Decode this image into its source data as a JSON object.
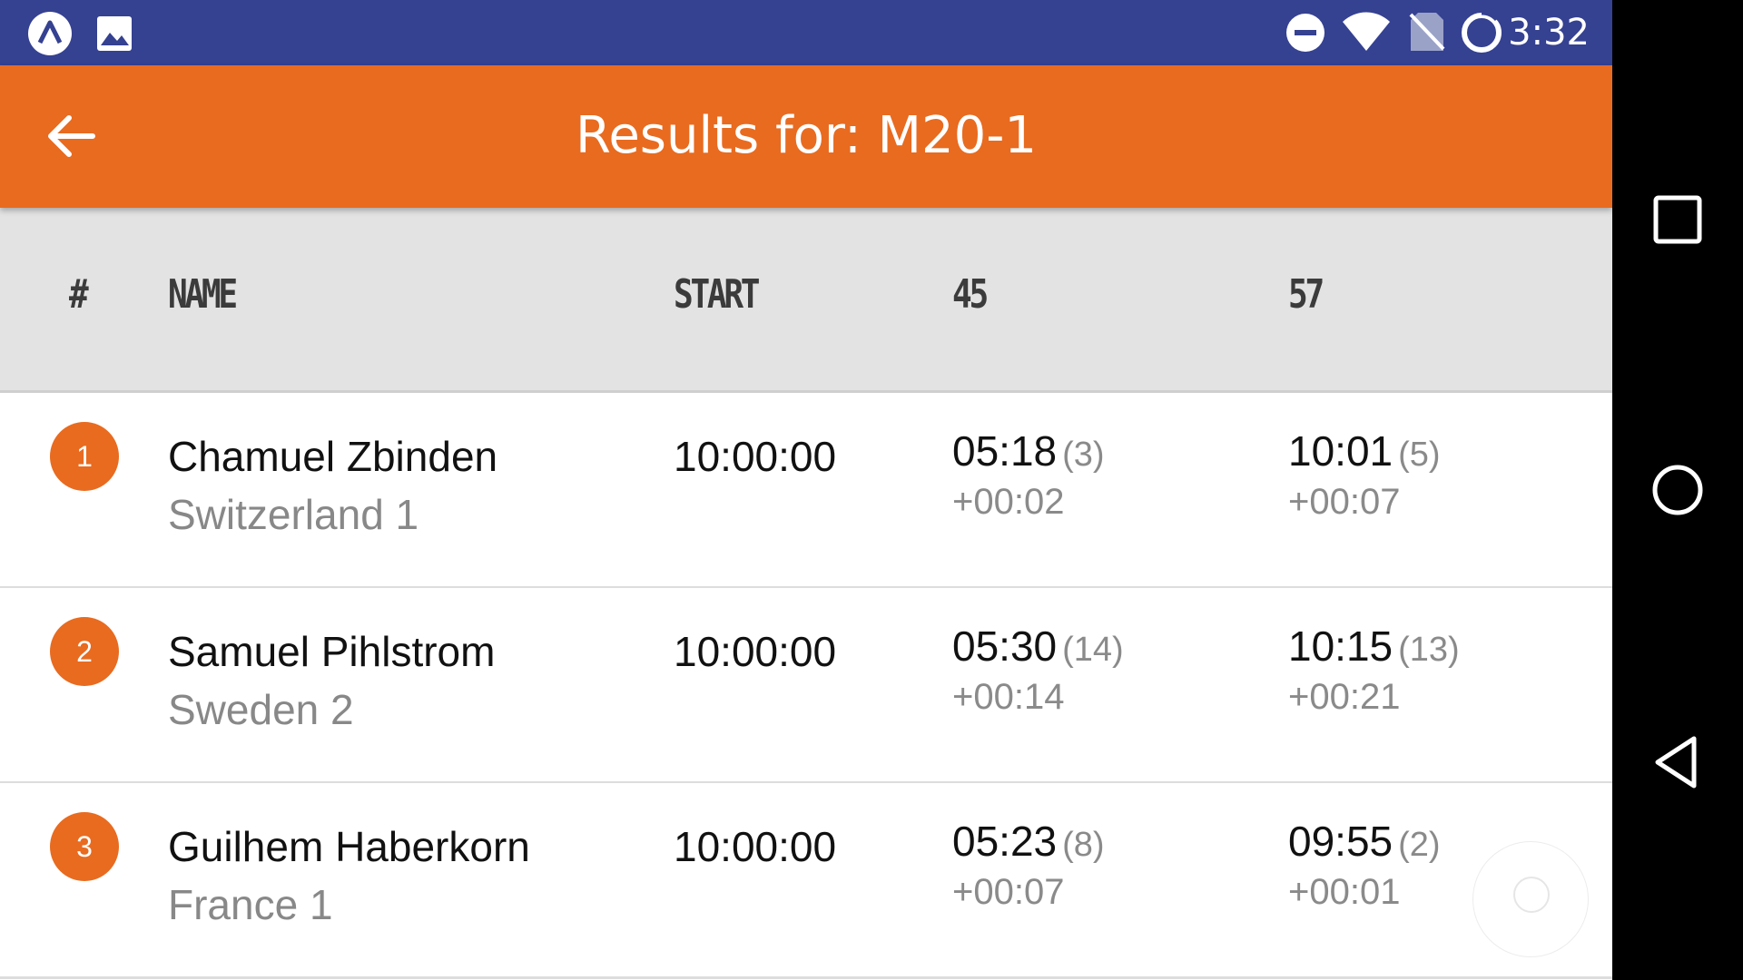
{
  "status_bar": {
    "time": "3:32",
    "left_icons": [
      "app-notification-icon",
      "image-notification-icon"
    ],
    "right_icons": [
      "do-not-disturb-icon",
      "wifi-icon",
      "no-sim-icon",
      "battery-icon"
    ]
  },
  "app_bar": {
    "title": "Results for: M20-1",
    "back_icon": "arrow-back-icon",
    "color": "#e86b20"
  },
  "table": {
    "headers": {
      "rank": "#",
      "name": "NAME",
      "start": "START",
      "split1": "45",
      "split2": "57"
    },
    "rows": [
      {
        "rank": "1",
        "name": "Chamuel Zbinden",
        "team": "Switzerland 1",
        "start": "10:00:00",
        "s1_time": "05:18",
        "s1_pos": "(3)",
        "s1_diff": "+00:02",
        "s2_time": "10:01",
        "s2_pos": "(5)",
        "s2_diff": "+00:07"
      },
      {
        "rank": "2",
        "name": "Samuel Pihlstrom",
        "team": "Sweden 2",
        "start": "10:00:00",
        "s1_time": "05:30",
        "s1_pos": "(14)",
        "s1_diff": "+00:14",
        "s2_time": "10:15",
        "s2_pos": "(13)",
        "s2_diff": "+00:21"
      },
      {
        "rank": "3",
        "name": "Guilhem Haberkorn",
        "team": "France 1",
        "start": "10:00:00",
        "s1_time": "05:23",
        "s1_pos": "(8)",
        "s1_diff": "+00:07",
        "s2_time": "09:55",
        "s2_pos": "(2)",
        "s2_diff": "+00:01"
      }
    ]
  },
  "nav_bar": {
    "buttons": [
      "recents-square-icon",
      "home-circle-icon",
      "back-triangle-icon"
    ]
  },
  "colors": {
    "status_bar": "#354191",
    "accent": "#e86b20",
    "header_bg": "#e3e3e3"
  }
}
